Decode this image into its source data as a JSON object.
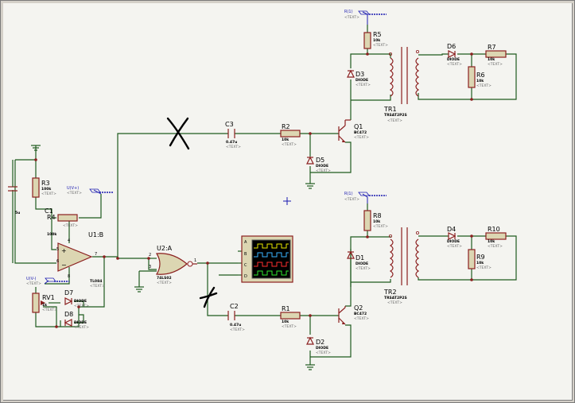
{
  "schematic": {
    "components": {
      "R5": {
        "ref": "R5",
        "value": "10k",
        "text": "<TEXT>"
      },
      "R7": {
        "ref": "R7",
        "value": "10k",
        "text": "<TEXT>"
      },
      "R6": {
        "ref": "R6",
        "value": "10k",
        "text": "<TEXT>"
      },
      "D6": {
        "ref": "D6",
        "value": "DIODE",
        "text": "<TEXT>"
      },
      "D3": {
        "ref": "D3",
        "value": "DIODE",
        "text": "<TEXT>"
      },
      "TR1": {
        "ref": "TR1",
        "value": "TRSAT2P2S",
        "text": "<TEXT>"
      },
      "C3": {
        "ref": "C3",
        "value": "0.47u",
        "text": "<TEXT>"
      },
      "R2": {
        "ref": "R2",
        "value": "10k",
        "text": "<TEXT>"
      },
      "Q1": {
        "ref": "Q1",
        "value": "BC472",
        "text": "<TEXT>"
      },
      "D5": {
        "ref": "D5",
        "value": "DIODE",
        "text": "<TEXT>"
      },
      "R3": {
        "ref": "R3",
        "value": "100k",
        "text": "<TEXT>"
      },
      "C1": {
        "ref": "C1",
        "value": "5u",
        "text": ""
      },
      "R4": {
        "ref": "R4",
        "value": "100k",
        "text": "<TEXT>"
      },
      "U1B": {
        "ref": "U1:B",
        "value": "TL084",
        "text": "<TEXT>"
      },
      "U2A": {
        "ref": "U2:A",
        "value": "74LS02",
        "text": "<TEXT>"
      },
      "RV1": {
        "ref": "RV1",
        "value": "1k",
        "text": "<TEXT>"
      },
      "D7": {
        "ref": "D7",
        "value": "DIODE",
        "text": "<TEXT>"
      },
      "D8": {
        "ref": "D8",
        "value": "DIODE",
        "text": "<TEXT>"
      },
      "R8": {
        "ref": "R8",
        "value": "10k",
        "text": "<TEXT>"
      },
      "D4": {
        "ref": "D4",
        "value": "DIODE",
        "text": "<TEXT>"
      },
      "R10": {
        "ref": "R10",
        "value": "10k",
        "text": "<TEXT>"
      },
      "R9": {
        "ref": "R9",
        "value": "10k",
        "text": "<TEXT>"
      },
      "D1": {
        "ref": "D1",
        "value": "DIODE",
        "text": "<TEXT>"
      },
      "TR2": {
        "ref": "TR2",
        "value": "TRSAT2P2S",
        "text": "<TEXT>"
      },
      "C2": {
        "ref": "C2",
        "value": "0.47u",
        "text": "<TEXT>"
      },
      "R1": {
        "ref": "R1",
        "value": "10k",
        "text": "<TEXT>"
      },
      "Q2": {
        "ref": "Q2",
        "value": "BC472",
        "text": "<TEXT>"
      },
      "D2": {
        "ref": "D2",
        "value": "DIODE",
        "text": "<TEXT>"
      }
    },
    "generators": {
      "top": {
        "label": "R(1)",
        "text": "<TEXT>"
      },
      "mid": {
        "label": "R(1)",
        "text": "<TEXT>"
      },
      "opamp_pos": {
        "label": "U(V+)",
        "text": "<TEXT>"
      },
      "opamp_neg": {
        "label": "U(V-)",
        "text": "<TEXT>"
      }
    },
    "opamp_pins": {
      "p5": "5",
      "p6": "6",
      "p7": "7",
      "p4": "4",
      "p8": "8"
    },
    "gate_pins": {
      "p2": "2",
      "p3": "3",
      "p1": "1"
    },
    "scope_channels": [
      "A",
      "B",
      "C",
      "D"
    ],
    "colors": {
      "wire": "#1e5a1e",
      "component": "#8b1f1f",
      "body": "#dcd6b2",
      "generator": "#1a1ab0",
      "background": "#f4f4f0"
    }
  }
}
